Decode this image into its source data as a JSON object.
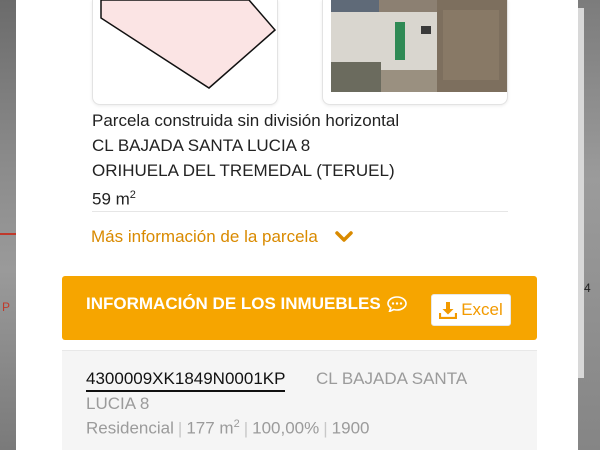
{
  "parcel": {
    "type_label": "Parcela construida sin división horizontal",
    "address": "CL BAJADA SANTA LUCIA 8",
    "municipality": "ORIHUELA DEL TREMEDAL (TERUEL)",
    "area_value": "59 m",
    "area_unit_sup": "2",
    "more_info_label": "Más información de la parcela"
  },
  "properties_section": {
    "title": "INFORMACIÓN DE LOS INMUEBLES",
    "excel_label": "Excel"
  },
  "property": {
    "reference": "4300009XK1849N0001KP",
    "address_line1": "CL BAJADA SANTA",
    "address_line2": "LUCIA 8",
    "use": "Residencial",
    "area_value": "177 m",
    "area_unit_sup": "2",
    "share": "100,00%",
    "year": "1900"
  },
  "map_labels": {
    "left": "P",
    "right": "4"
  },
  "colors": {
    "accent_orange": "#f6a500",
    "link_orange": "#d98a00",
    "parcel_fill": "#fbe4e4"
  },
  "icons": {
    "expand": "chevron-down-icon",
    "info": "speech-bubble-icon",
    "download": "download-icon"
  }
}
